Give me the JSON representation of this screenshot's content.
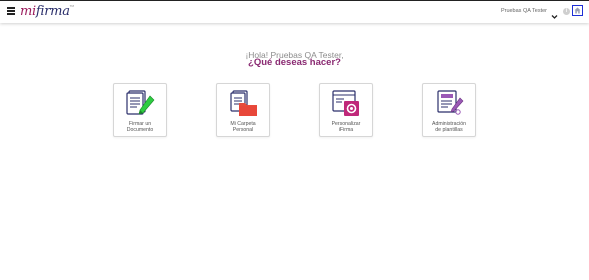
{
  "header": {
    "logo_main": "mi",
    "logo_accent": "firma",
    "logo_mark": "TM",
    "user_name": "Pruebas QA Tester",
    "icons": {
      "menu": "hamburger-menu-icon",
      "logo": "mifirma-logo",
      "dropdown": "chevron-down-icon",
      "info": "info-icon",
      "home": "home-icon"
    },
    "info_glyph": "i",
    "colors": {
      "brand_magenta": "#9b1c5d",
      "brand_navy": "#2b2f6b",
      "focus_blue": "#1e2fd6"
    }
  },
  "main": {
    "greeting": "¡Hola! Pruebas QA Tester,",
    "question": "¿Qué deseas hacer?",
    "question_color": "#8a2a72",
    "options": [
      {
        "label_line1": "Firmar un",
        "label_line2": "Documento",
        "icon": "sign-document-icon",
        "accent": "#2ecc40"
      },
      {
        "label_line1": "Mi Carpeta",
        "label_line2": "Personal",
        "icon": "personal-folder-icon",
        "accent": "#e74c3c"
      },
      {
        "label_line1": "Personalizar",
        "label_line2": "iFirma",
        "icon": "customize-settings-icon",
        "accent": "#c0287a"
      },
      {
        "label_line1": "Administración",
        "label_line2": "de plantillas",
        "icon": "template-admin-icon",
        "accent": "#9b59b6"
      }
    ]
  }
}
